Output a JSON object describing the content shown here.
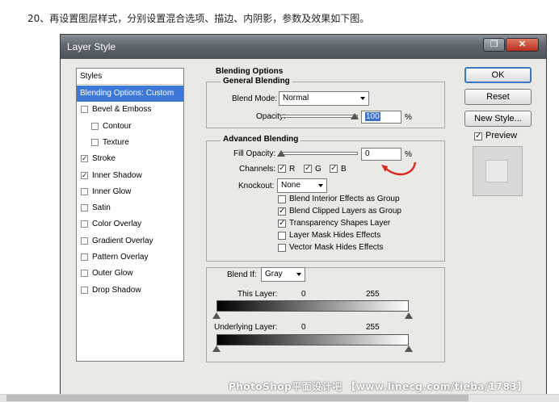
{
  "caption": "20、再设置图层样式，分别设置混合选项、描边、内阴影，参数及效果如下图。",
  "dialog": {
    "title": "Layer Style"
  },
  "sidebar": {
    "header": "Styles",
    "items": [
      {
        "label": "Blending Options: Custom",
        "selected": true,
        "checkbox": false,
        "checked": false,
        "indent": false
      },
      {
        "label": "Bevel & Emboss",
        "checkbox": true,
        "checked": false,
        "indent": false
      },
      {
        "label": "Contour",
        "checkbox": true,
        "checked": false,
        "indent": true
      },
      {
        "label": "Texture",
        "checkbox": true,
        "checked": false,
        "indent": true
      },
      {
        "label": "Stroke",
        "checkbox": true,
        "checked": true,
        "indent": false
      },
      {
        "label": "Inner Shadow",
        "checkbox": true,
        "checked": true,
        "indent": false
      },
      {
        "label": "Inner Glow",
        "checkbox": true,
        "checked": false,
        "indent": false
      },
      {
        "label": "Satin",
        "checkbox": true,
        "checked": false,
        "indent": false
      },
      {
        "label": "Color Overlay",
        "checkbox": true,
        "checked": false,
        "indent": false
      },
      {
        "label": "Gradient Overlay",
        "checkbox": true,
        "checked": false,
        "indent": false
      },
      {
        "label": "Pattern Overlay",
        "checkbox": true,
        "checked": false,
        "indent": false
      },
      {
        "label": "Outer Glow",
        "checkbox": true,
        "checked": false,
        "indent": false
      },
      {
        "label": "Drop Shadow",
        "checkbox": true,
        "checked": false,
        "indent": false
      }
    ]
  },
  "blending": {
    "section_title": "Blending Options",
    "general_title": "General Blending",
    "blend_mode_label": "Blend Mode:",
    "blend_mode_value": "Normal",
    "opacity_label": "Opacity:",
    "opacity_value": "100",
    "percent": "%"
  },
  "advanced": {
    "title": "Advanced Blending",
    "fill_opacity_label": "Fill Opacity:",
    "fill_opacity_value": "0",
    "channels_label": "Channels:",
    "channels": [
      {
        "label": "R",
        "checked": true
      },
      {
        "label": "G",
        "checked": true
      },
      {
        "label": "B",
        "checked": true
      }
    ],
    "knockout_label": "Knockout:",
    "knockout_value": "None",
    "options": [
      {
        "label": "Blend Interior Effects as Group",
        "checked": false
      },
      {
        "label": "Blend Clipped Layers as Group",
        "checked": true
      },
      {
        "label": "Transparency Shapes Layer",
        "checked": true
      },
      {
        "label": "Layer Mask Hides Effects",
        "checked": false
      },
      {
        "label": "Vector Mask Hides Effects",
        "checked": false
      }
    ]
  },
  "blend_if": {
    "label": "Blend If:",
    "value": "Gray",
    "this_layer_label": "This Layer:",
    "this_layer_min": "0",
    "this_layer_max": "255",
    "underlying_label": "Underlying Layer:",
    "underlying_min": "0",
    "underlying_max": "255"
  },
  "buttons": {
    "ok": "OK",
    "reset": "Reset",
    "new_style": "New Style...",
    "preview": "Preview",
    "preview_checked": true
  },
  "annotation_color": "#d9251c",
  "watermark": "PhotoShop平面设计吧 【www.linecg.com/tieba/1783】"
}
